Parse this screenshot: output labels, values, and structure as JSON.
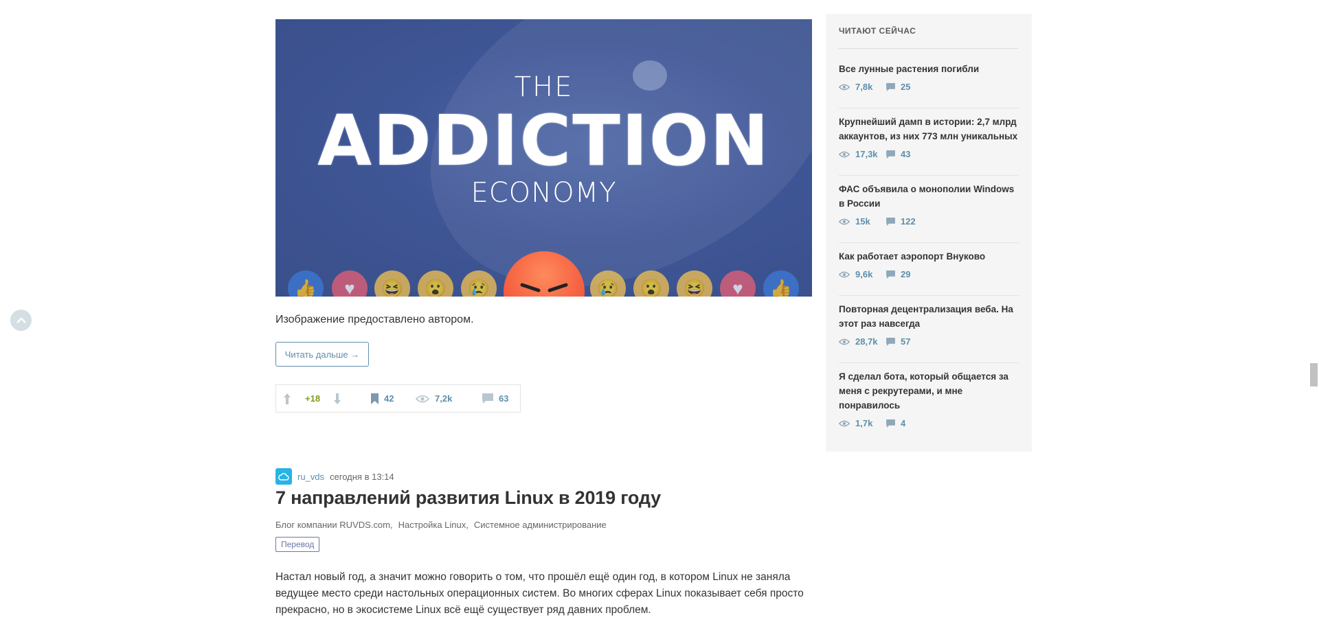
{
  "banner": {
    "the": "THE",
    "main": "ADDICTION",
    "economy": "ECONOMY"
  },
  "post1": {
    "caption": "Изображение предоставлено автором.",
    "read_more": "Читать дальше →",
    "score": "+18",
    "bookmarks": "42",
    "views": "7,2k",
    "comments": "63"
  },
  "post2": {
    "author": "ru_vds",
    "date": "сегодня в 13:14",
    "title": "7 направлений развития Linux в 2019 году",
    "hubs": [
      "Блог компании RUVDS.com,",
      "Настройка Linux,",
      "Системное администрирование"
    ],
    "badge": "Перевод",
    "lead": "Настал новый год, а значит можно говорить о том, что прошёл ещё один год, в котором Linux не заняла ведущее место среди настольных операционных систем. Во многих сферах Linux показывает себя просто прекрасно, но в экосистеме Linux всё ещё существует ряд давних проблем."
  },
  "sidebar": {
    "title": "ЧИТАЮТ СЕЙЧАС",
    "items": [
      {
        "title": "Все лунные растения погибли",
        "views": "7,8k",
        "comments": "25"
      },
      {
        "title": "Крупнейший дамп в истории: 2,7 млрд аккаунтов, из них 773 млн уникальных",
        "views": "17,3k",
        "comments": "43"
      },
      {
        "title": "ФАС объявила о монополии Windows в России",
        "views": "15k",
        "comments": "122"
      },
      {
        "title": "Как работает аэропорт Внуково",
        "views": "9,6k",
        "comments": "29"
      },
      {
        "title": "Повторная децентрализация веба. На этот раз навсегда",
        "views": "28,7k",
        "comments": "57"
      },
      {
        "title": "Я сделал бота, который общается за меня с рекрутерами, и мне понравилось",
        "views": "1,7k",
        "comments": "4"
      }
    ]
  },
  "colors": {
    "link": "#5e8eac",
    "score_positive": "#7b9e1a",
    "banner_bg": "#3f5696",
    "sidebar_bg": "#f5f5f5"
  }
}
